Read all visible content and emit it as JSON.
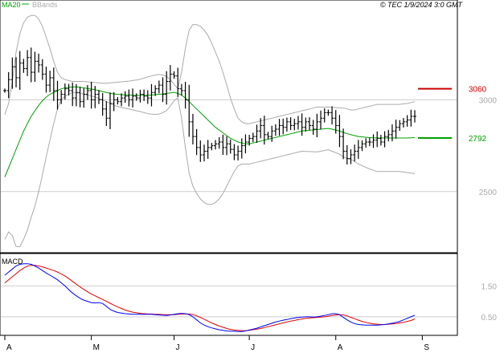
{
  "header": {
    "ma_label": "MA20",
    "bb_label": "BBands",
    "ticker_info": "© TEC 1/9/2024 3:0 GMT"
  },
  "colors": {
    "price": "#000000",
    "ma20": "#00a000",
    "bbands": "#aaaaaa",
    "macd": "#0000ff",
    "signal": "#e00000",
    "resistance": "#cc0000",
    "support": "#00a000",
    "grid": "#cccccc",
    "axis_text": "#aaaaaa"
  },
  "chart_data": [
    {
      "type": "line",
      "name": "price-panel",
      "ylim": [
        2180,
        3500
      ],
      "y_ticks": [
        {
          "value": 3000,
          "label": "3000"
        },
        {
          "value": 2500,
          "label": "2500"
        }
      ],
      "x_ticks": [
        {
          "index": 0,
          "label": "A"
        },
        {
          "index": 23,
          "label": "M"
        },
        {
          "index": 45,
          "label": "J"
        },
        {
          "index": 65,
          "label": "J"
        },
        {
          "index": 88,
          "label": "A"
        },
        {
          "index": 111,
          "label": "S"
        }
      ],
      "levels": [
        {
          "name": "resistance",
          "value": 3060,
          "label": "3060"
        },
        {
          "name": "support",
          "value": 2792,
          "label": "2792"
        }
      ],
      "close": [
        3050,
        3110,
        3180,
        3120,
        3200,
        3170,
        3230,
        3150,
        3210,
        3190,
        3140,
        3080,
        3120,
        3050,
        3000,
        3030,
        3060,
        3050,
        3010,
        3040,
        2990,
        3030,
        3050,
        3000,
        3030,
        3000,
        2950,
        2900,
        2980,
        3000,
        2990,
        3010,
        3020,
        3000,
        3020,
        3010,
        3030,
        3020,
        3010,
        3040,
        3060,
        3080,
        3030,
        3100,
        3140,
        3130,
        3060,
        3050,
        3000,
        2880,
        2800,
        2740,
        2700,
        2720,
        2740,
        2750,
        2760,
        2770,
        2740,
        2760,
        2730,
        2700,
        2720,
        2750,
        2770,
        2790,
        2800,
        2830,
        2860,
        2810,
        2800,
        2830,
        2840,
        2860,
        2850,
        2880,
        2860,
        2870,
        2880,
        2850,
        2880,
        2860,
        2840,
        2880,
        2900,
        2930,
        2930,
        2900,
        2860,
        2800,
        2720,
        2680,
        2700,
        2720,
        2740,
        2760,
        2770,
        2770,
        2780,
        2790,
        2770,
        2800,
        2810,
        2830,
        2850,
        2870,
        2880,
        2890,
        2910,
        2910
      ],
      "ma20": [
        2580,
        2630,
        2680,
        2730,
        2780,
        2830,
        2870,
        2910,
        2940,
        2970,
        2995,
        3015,
        3030,
        3040,
        3050,
        3060,
        3065,
        3068,
        3070,
        3070,
        3068,
        3065,
        3062,
        3058,
        3055,
        3050,
        3045,
        3040,
        3036,
        3032,
        3030,
        3028,
        3027,
        3026,
        3025,
        3024,
        3024,
        3024,
        3025,
        3026,
        3028,
        3030,
        3032,
        3035,
        3038,
        3040,
        3035,
        3025,
        3010,
        2990,
        2970,
        2950,
        2930,
        2910,
        2890,
        2870,
        2850,
        2835,
        2820,
        2805,
        2790,
        2780,
        2770,
        2765,
        2760,
        2760,
        2765,
        2770,
        2775,
        2780,
        2785,
        2790,
        2795,
        2800,
        2805,
        2810,
        2815,
        2820,
        2825,
        2830,
        2832,
        2834,
        2836,
        2838,
        2840,
        2842,
        2844,
        2840,
        2835,
        2830,
        2822,
        2815,
        2810,
        2805,
        2800,
        2798,
        2796,
        2794,
        2793,
        2792,
        2792,
        2792,
        2792,
        2792,
        2792,
        2792,
        2792,
        2792,
        2793,
        2794
      ],
      "bb_upper": [
        2920,
        2980,
        3100,
        3260,
        3360,
        3420,
        3450,
        3460,
        3460,
        3440,
        3400,
        3340,
        3280,
        3210,
        3150,
        3120,
        3110,
        3105,
        3100,
        3100,
        3100,
        3100,
        3098,
        3096,
        3094,
        3092,
        3090,
        3090,
        3092,
        3094,
        3096,
        3098,
        3100,
        3102,
        3105,
        3108,
        3112,
        3118,
        3125,
        3130,
        3135,
        3138,
        3135,
        3128,
        3110,
        3085,
        3060,
        3150,
        3280,
        3380,
        3410,
        3410,
        3400,
        3380,
        3350,
        3310,
        3260,
        3210,
        3150,
        3080,
        3010,
        2950,
        2900,
        2880,
        2870,
        2870,
        2875,
        2880,
        2885,
        2890,
        2895,
        2900,
        2905,
        2910,
        2915,
        2920,
        2925,
        2930,
        2935,
        2940,
        2945,
        2950,
        2955,
        2960,
        2960,
        2960,
        2960,
        2960,
        2958,
        2956,
        2955,
        2950,
        2945,
        2945,
        2950,
        2955,
        2960,
        2965,
        2970,
        2975,
        2975,
        2975,
        2975,
        2975,
        2975,
        2975,
        2978,
        2980,
        2985,
        2990
      ],
      "bb_lower": [
        2240,
        2280,
        2260,
        2200,
        2200,
        2240,
        2290,
        2360,
        2420,
        2500,
        2590,
        2690,
        2780,
        2870,
        2950,
        3000,
        3020,
        3030,
        3040,
        3040,
        3036,
        3030,
        3026,
        3020,
        3016,
        3008,
        3000,
        2990,
        2980,
        2970,
        2964,
        2958,
        2954,
        2950,
        2945,
        2940,
        2936,
        2930,
        2925,
        2922,
        2921,
        2922,
        2929,
        2942,
        2966,
        2995,
        3010,
        2900,
        2740,
        2600,
        2530,
        2490,
        2460,
        2440,
        2430,
        2430,
        2440,
        2460,
        2490,
        2530,
        2570,
        2610,
        2640,
        2650,
        2650,
        2650,
        2655,
        2660,
        2665,
        2670,
        2675,
        2680,
        2685,
        2690,
        2695,
        2700,
        2705,
        2710,
        2715,
        2720,
        2719,
        2718,
        2717,
        2716,
        2720,
        2724,
        2728,
        2720,
        2712,
        2704,
        2689,
        2680,
        2675,
        2665,
        2650,
        2641,
        2632,
        2623,
        2616,
        2609,
        2609,
        2609,
        2609,
        2609,
        2609,
        2609,
        2606,
        2604,
        2601,
        2598
      ]
    },
    {
      "type": "line",
      "name": "macd-panel",
      "title": "MACD",
      "ylim": [
        -0.05,
        2.5
      ],
      "y_ticks": [
        {
          "value": 1.5,
          "label": "1.50"
        },
        {
          "value": 0.5,
          "label": "0.50"
        }
      ],
      "macd": [
        1.85,
        1.95,
        2.05,
        2.15,
        2.2,
        2.22,
        2.22,
        2.2,
        2.15,
        2.08,
        2.0,
        1.92,
        1.85,
        1.78,
        1.7,
        1.6,
        1.5,
        1.38,
        1.27,
        1.18,
        1.1,
        1.04,
        1.0,
        0.96,
        0.95,
        0.96,
        0.93,
        0.84,
        0.74,
        0.68,
        0.64,
        0.62,
        0.6,
        0.59,
        0.58,
        0.58,
        0.58,
        0.58,
        0.58,
        0.58,
        0.57,
        0.56,
        0.55,
        0.54,
        0.56,
        0.58,
        0.6,
        0.61,
        0.6,
        0.57,
        0.5,
        0.4,
        0.3,
        0.23,
        0.18,
        0.14,
        0.11,
        0.08,
        0.06,
        0.04,
        0.03,
        0.03,
        0.02,
        0.02,
        0.04,
        0.07,
        0.1,
        0.13,
        0.17,
        0.21,
        0.25,
        0.29,
        0.33,
        0.36,
        0.39,
        0.41,
        0.44,
        0.46,
        0.48,
        0.49,
        0.5,
        0.5,
        0.49,
        0.5,
        0.52,
        0.54,
        0.57,
        0.6,
        0.6,
        0.57,
        0.48,
        0.4,
        0.33,
        0.28,
        0.25,
        0.24,
        0.23,
        0.23,
        0.23,
        0.23,
        0.24,
        0.25,
        0.27,
        0.29,
        0.32,
        0.35,
        0.4,
        0.45,
        0.5,
        0.55
      ],
      "signal": [
        1.6,
        1.7,
        1.8,
        1.9,
        2.0,
        2.08,
        2.14,
        2.17,
        2.17,
        2.15,
        2.12,
        2.08,
        2.04,
        2.0,
        1.95,
        1.89,
        1.82,
        1.74,
        1.65,
        1.56,
        1.47,
        1.39,
        1.31,
        1.24,
        1.18,
        1.12,
        1.06,
        1.0,
        0.94,
        0.88,
        0.82,
        0.77,
        0.72,
        0.68,
        0.65,
        0.63,
        0.61,
        0.6,
        0.59,
        0.59,
        0.58,
        0.58,
        0.57,
        0.57,
        0.57,
        0.57,
        0.58,
        0.59,
        0.59,
        0.59,
        0.57,
        0.53,
        0.48,
        0.42,
        0.36,
        0.3,
        0.25,
        0.2,
        0.16,
        0.12,
        0.09,
        0.07,
        0.06,
        0.05,
        0.05,
        0.06,
        0.08,
        0.1,
        0.12,
        0.15,
        0.18,
        0.21,
        0.24,
        0.27,
        0.3,
        0.33,
        0.36,
        0.38,
        0.41,
        0.43,
        0.45,
        0.46,
        0.47,
        0.48,
        0.49,
        0.5,
        0.52,
        0.54,
        0.56,
        0.57,
        0.56,
        0.53,
        0.48,
        0.44,
        0.39,
        0.35,
        0.32,
        0.29,
        0.27,
        0.26,
        0.25,
        0.25,
        0.26,
        0.27,
        0.28,
        0.3,
        0.32,
        0.35,
        0.38,
        0.43
      ]
    }
  ]
}
